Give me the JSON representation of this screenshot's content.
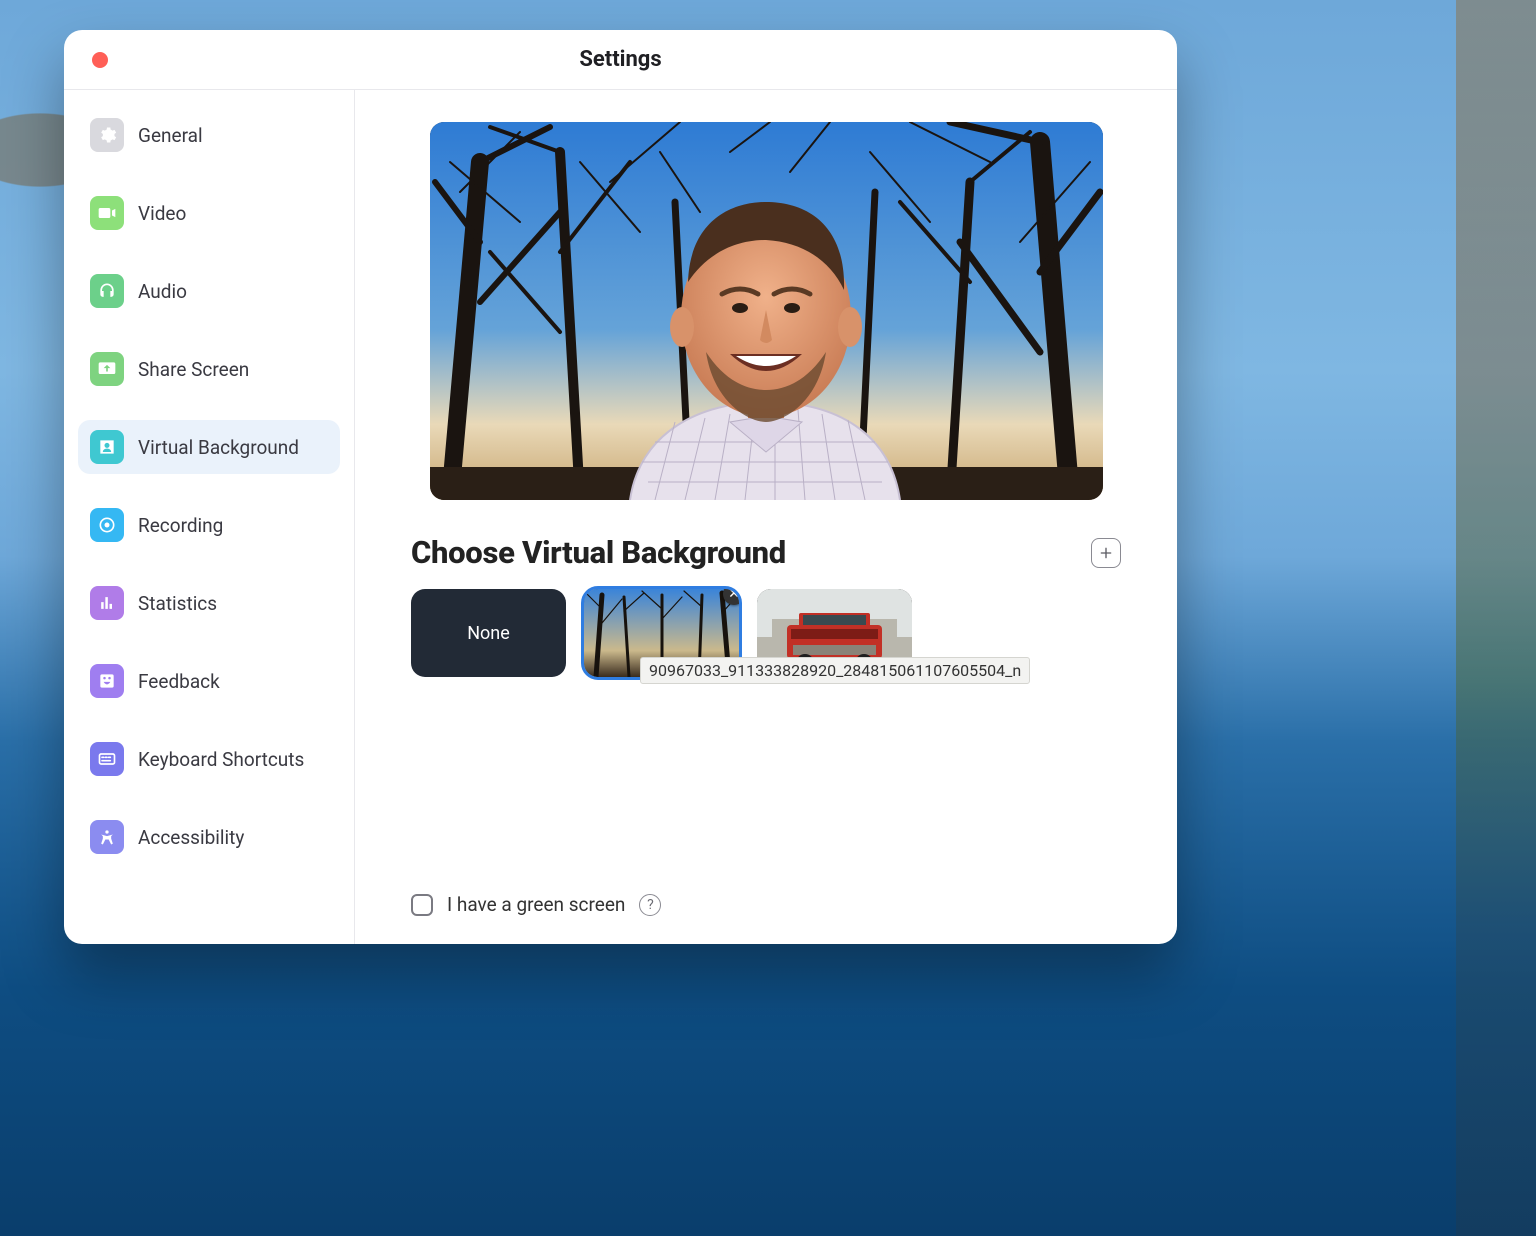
{
  "window": {
    "title": "Settings"
  },
  "sidebar": {
    "items": [
      {
        "label": "General"
      },
      {
        "label": "Video"
      },
      {
        "label": "Audio"
      },
      {
        "label": "Share Screen"
      },
      {
        "label": "Virtual Background"
      },
      {
        "label": "Recording"
      },
      {
        "label": "Statistics"
      },
      {
        "label": "Feedback"
      },
      {
        "label": "Keyboard Shortcuts"
      },
      {
        "label": "Accessibility"
      }
    ],
    "active_index": 4
  },
  "main": {
    "section_title": "Choose Virtual Background",
    "none_label": "None",
    "tooltip_filename": "90967033_911333828920_284815061107605504_n",
    "green_screen_label": "I have a green screen",
    "green_screen_checked": false
  }
}
